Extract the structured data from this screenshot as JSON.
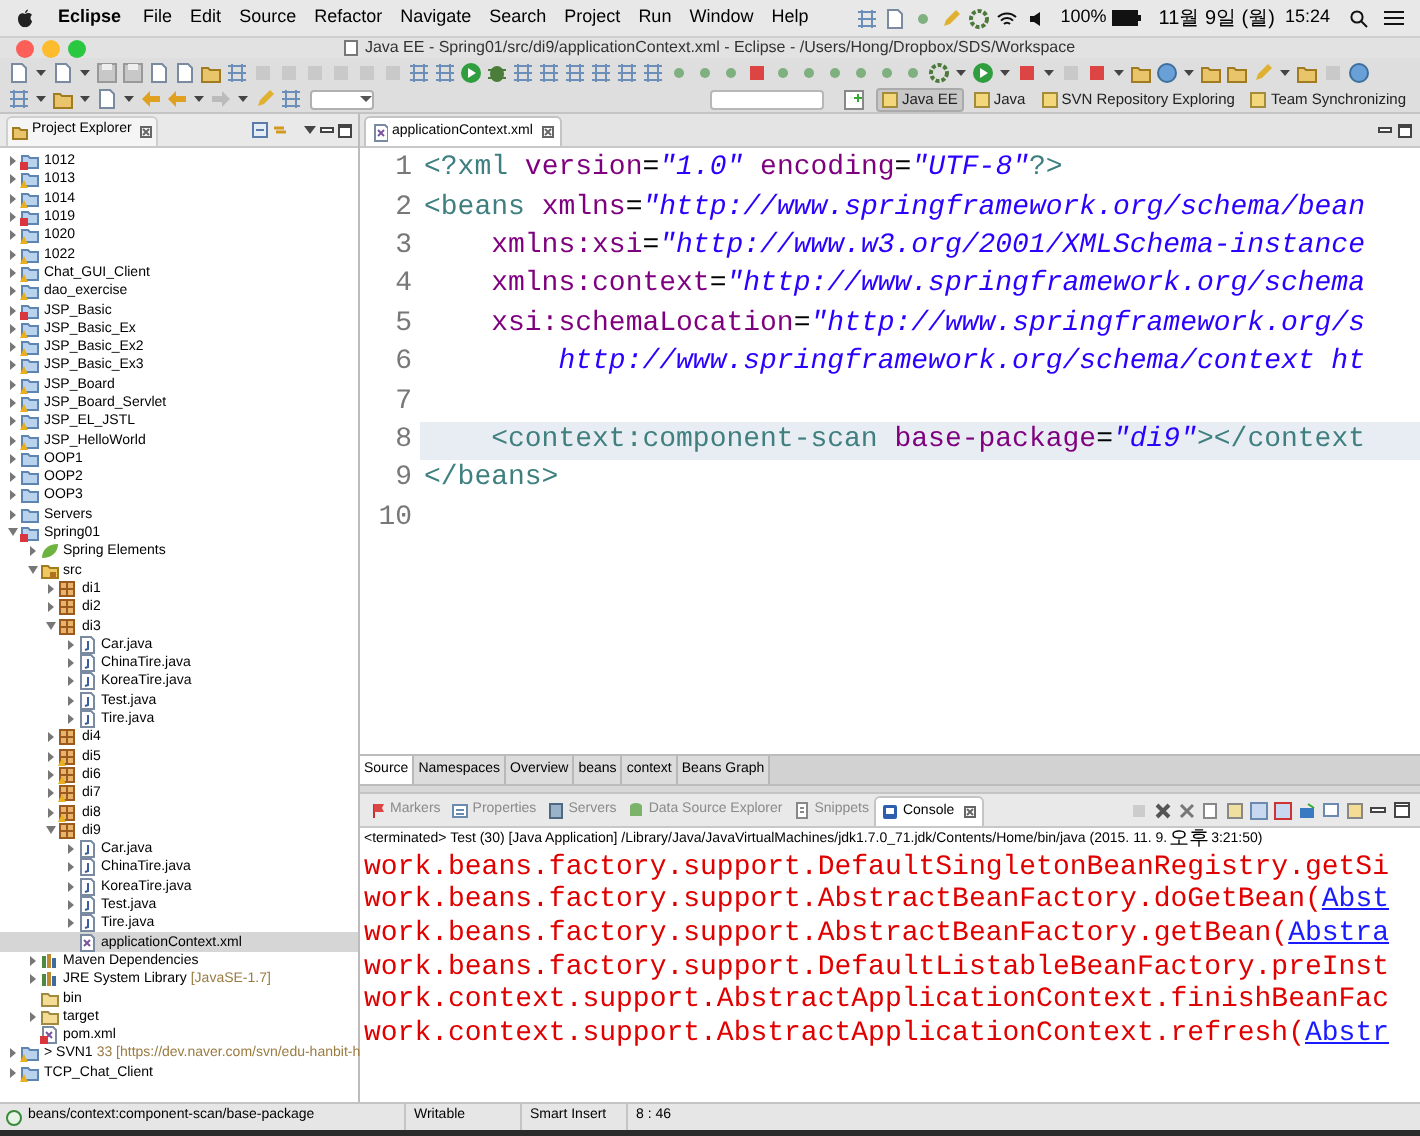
{
  "menubar": {
    "items": [
      {
        "label": "Eclipse",
        "kind": "app"
      },
      {
        "label": "File",
        "kind": "menu"
      },
      {
        "label": "Edit",
        "kind": "menu"
      },
      {
        "label": "Source",
        "kind": "menu"
      },
      {
        "label": "Refactor",
        "kind": "menu"
      },
      {
        "label": "Navigate",
        "kind": "menu"
      },
      {
        "label": "Search",
        "kind": "menu"
      },
      {
        "label": "Project",
        "kind": "menu"
      },
      {
        "label": "Run",
        "kind": "menu"
      },
      {
        "label": "Window",
        "kind": "menu"
      },
      {
        "label": "Help",
        "kind": "menu"
      }
    ],
    "battery": "100%",
    "date": "11월 9일 (월)",
    "time": "15:24"
  },
  "window": {
    "title": "Java EE - Spring01/src/di9/applicationContext.xml - Eclipse - /Users/Hong/Dropbox/SDS/Workspace"
  },
  "perspectives": [
    {
      "label": "Java EE",
      "selected": true
    },
    {
      "label": "Java",
      "selected": false
    },
    {
      "label": "SVN Repository Exploring",
      "selected": false
    },
    {
      "label": "Team Synchronizing",
      "selected": false
    }
  ],
  "project_explorer": {
    "title": "Project Explorer",
    "tree": [
      {
        "label": "1012",
        "kind": "project",
        "error": true,
        "expanded": false,
        "selected": false
      },
      {
        "label": "1013",
        "kind": "project",
        "warning": true,
        "expanded": false,
        "selected": false
      },
      {
        "label": "1014",
        "kind": "project",
        "warning": true,
        "expanded": false,
        "selected": false
      },
      {
        "label": "1019",
        "kind": "project",
        "error": true,
        "expanded": false,
        "selected": false
      },
      {
        "label": "1020",
        "kind": "project",
        "warning": true,
        "expanded": false,
        "selected": false
      },
      {
        "label": "1022",
        "kind": "project",
        "warning": true,
        "expanded": false,
        "selected": false
      },
      {
        "label": "Chat_GUI_Client",
        "kind": "project",
        "warning": true,
        "expanded": false,
        "selected": false
      },
      {
        "label": "dao_exercise",
        "kind": "project",
        "warning": true,
        "expanded": false,
        "selected": false
      },
      {
        "label": "JSP_Basic",
        "kind": "project",
        "error": true,
        "expanded": false,
        "selected": false
      },
      {
        "label": "JSP_Basic_Ex",
        "kind": "project",
        "warning": true,
        "expanded": false,
        "selected": false
      },
      {
        "label": "JSP_Basic_Ex2",
        "kind": "project",
        "warning": true,
        "expanded": false,
        "selected": false
      },
      {
        "label": "JSP_Basic_Ex3",
        "kind": "project",
        "warning": true,
        "expanded": false,
        "selected": false
      },
      {
        "label": "JSP_Board",
        "kind": "project",
        "warning": true,
        "expanded": false,
        "selected": false
      },
      {
        "label": "JSP_Board_Servlet",
        "kind": "project",
        "warning": true,
        "expanded": false,
        "selected": false
      },
      {
        "label": "JSP_EL_JSTL",
        "kind": "project",
        "warning": true,
        "expanded": false,
        "selected": false
      },
      {
        "label": "JSP_HelloWorld",
        "kind": "project",
        "warning": true,
        "expanded": false,
        "selected": false
      },
      {
        "label": "OOP1",
        "kind": "project",
        "expanded": false,
        "selected": false
      },
      {
        "label": "OOP2",
        "kind": "project",
        "expanded": false,
        "selected": false
      },
      {
        "label": "OOP3",
        "kind": "project",
        "expanded": false,
        "selected": false
      },
      {
        "label": "Servers",
        "kind": "project",
        "expanded": false,
        "selected": false
      },
      {
        "label": "Spring01",
        "kind": "project",
        "error": true,
        "expanded": true,
        "selected": false,
        "children": [
          {
            "label": "Spring Elements",
            "kind": "spring",
            "expanded": false,
            "selected": false
          },
          {
            "label": "src",
            "kind": "source",
            "expanded": true,
            "selected": false,
            "children": [
              {
                "label": "di1",
                "kind": "package",
                "expanded": false,
                "selected": false
              },
              {
                "label": "di2",
                "kind": "package",
                "expanded": false,
                "selected": false
              },
              {
                "label": "di3",
                "kind": "package",
                "expanded": true,
                "selected": false,
                "children": [
                  {
                    "label": "Car.java",
                    "kind": "java",
                    "expanded": false,
                    "selected": false
                  },
                  {
                    "label": "ChinaTire.java",
                    "kind": "java",
                    "expanded": false,
                    "selected": false
                  },
                  {
                    "label": "KoreaTire.java",
                    "kind": "java",
                    "expanded": false,
                    "selected": false
                  },
                  {
                    "label": "Test.java",
                    "kind": "java",
                    "expanded": false,
                    "selected": false
                  },
                  {
                    "label": "Tire.java",
                    "kind": "java",
                    "expanded": false,
                    "selected": false
                  }
                ]
              },
              {
                "label": "di4",
                "kind": "package",
                "expanded": false,
                "selected": false
              },
              {
                "label": "di5",
                "kind": "package",
                "warning": true,
                "expanded": false,
                "selected": false
              },
              {
                "label": "di6",
                "kind": "package",
                "warning": true,
                "expanded": false,
                "selected": false
              },
              {
                "label": "di7",
                "kind": "package",
                "warning": true,
                "expanded": false,
                "selected": false
              },
              {
                "label": "di8",
                "kind": "package",
                "warning": true,
                "expanded": false,
                "selected": false
              },
              {
                "label": "di9",
                "kind": "package",
                "expanded": true,
                "selected": false,
                "children": [
                  {
                    "label": "Car.java",
                    "kind": "java",
                    "expanded": false,
                    "selected": false
                  },
                  {
                    "label": "ChinaTire.java",
                    "kind": "java",
                    "expanded": false,
                    "selected": false
                  },
                  {
                    "label": "KoreaTire.java",
                    "kind": "java",
                    "expanded": false,
                    "selected": false
                  },
                  {
                    "label": "Test.java",
                    "kind": "java",
                    "expanded": false,
                    "selected": false
                  },
                  {
                    "label": "Tire.java",
                    "kind": "java",
                    "expanded": false,
                    "selected": false
                  },
                  {
                    "label": "applicationContext.xml",
                    "kind": "xml",
                    "selected": true
                  }
                ]
              }
            ]
          },
          {
            "label": "Maven Dependencies",
            "kind": "library",
            "expanded": false,
            "selected": false
          },
          {
            "label": "JRE System Library",
            "decoration": "[JavaSE-1.7]",
            "kind": "library",
            "expanded": false,
            "selected": false
          },
          {
            "label": "bin",
            "kind": "folder",
            "selected": false
          },
          {
            "label": "target",
            "kind": "folder",
            "expanded": false,
            "selected": false
          },
          {
            "label": "pom.xml",
            "kind": "xml",
            "error": true,
            "selected": false
          }
        ]
      },
      {
        "label": "> SVN1",
        "decoration": "33 [https://dev.naver.com/svn/edu-hanbit-h",
        "kind": "project",
        "warning": true,
        "expanded": false,
        "selected": false
      },
      {
        "label": "TCP_Chat_Client",
        "kind": "project",
        "warning": true,
        "expanded": false,
        "selected": false
      }
    ]
  },
  "editor": {
    "tab": "applicationContext.xml",
    "lines": [
      {
        "number": "1",
        "current": false,
        "tokens": [
          {
            "kind": "pi",
            "text": "<?xml"
          },
          {
            "kind": "attr",
            "text": " version"
          },
          {
            "kind": "plain",
            "text": "="
          },
          {
            "kind": "value",
            "text": "\"1.0\""
          },
          {
            "kind": "attr",
            "text": " encoding"
          },
          {
            "kind": "plain",
            "text": "="
          },
          {
            "kind": "value",
            "text": "\"UTF-8\""
          },
          {
            "kind": "pi",
            "text": "?>"
          }
        ]
      },
      {
        "number": "2",
        "current": false,
        "tokens": [
          {
            "kind": "tag",
            "text": "<beans"
          },
          {
            "kind": "attr",
            "text": " xmlns"
          },
          {
            "kind": "plain",
            "text": "="
          },
          {
            "kind": "value",
            "text": "\"http://www.springframework.org/schema/bean"
          }
        ]
      },
      {
        "number": "3",
        "current": false,
        "tokens": [
          {
            "kind": "attr",
            "text": "    xmlns:xsi"
          },
          {
            "kind": "plain",
            "text": "="
          },
          {
            "kind": "value",
            "text": "\"http://www.w3.org/2001/XMLSchema-instance"
          }
        ]
      },
      {
        "number": "4",
        "current": false,
        "tokens": [
          {
            "kind": "attr",
            "text": "    xmlns:context"
          },
          {
            "kind": "plain",
            "text": "="
          },
          {
            "kind": "value",
            "text": "\"http://www.springframework.org/schema"
          }
        ]
      },
      {
        "number": "5",
        "current": false,
        "tokens": [
          {
            "kind": "attr",
            "text": "    xsi:schemaLocation"
          },
          {
            "kind": "plain",
            "text": "="
          },
          {
            "kind": "value",
            "text": "\"http://www.springframework.org/s"
          }
        ]
      },
      {
        "number": "6",
        "current": false,
        "tokens": [
          {
            "kind": "value",
            "text": "        http://www.springframework.org/schema/context ht"
          }
        ]
      },
      {
        "number": "7",
        "current": false
      },
      {
        "number": "8",
        "current": true,
        "tokens": [
          {
            "kind": "tag",
            "text": "    <context:component-scan"
          },
          {
            "kind": "attr",
            "text": " base-package"
          },
          {
            "kind": "plain",
            "text": "="
          },
          {
            "kind": "value",
            "text": "\"di9\""
          },
          {
            "kind": "tag",
            "text": "></context"
          }
        ]
      },
      {
        "number": "9",
        "current": false,
        "tokens": [
          {
            "kind": "tag",
            "text": "</beans>"
          }
        ]
      },
      {
        "number": "10",
        "current": false
      }
    ],
    "bottom_tabs": [
      {
        "label": "Source",
        "selected": true
      },
      {
        "label": "Namespaces",
        "selected": false
      },
      {
        "label": "Overview",
        "selected": false
      },
      {
        "label": "beans",
        "selected": false
      },
      {
        "label": "context",
        "selected": false
      },
      {
        "label": "Beans Graph",
        "selected": false
      }
    ]
  },
  "bottom_views": [
    {
      "label": "Markers",
      "kind": "markers",
      "selected": false
    },
    {
      "label": "Properties",
      "kind": "properties",
      "selected": false
    },
    {
      "label": "Servers",
      "kind": "servers",
      "selected": false
    },
    {
      "label": "Data Source Explorer",
      "kind": "datasource",
      "selected": false
    },
    {
      "label": "Snippets",
      "kind": "snippets",
      "selected": false
    },
    {
      "label": "Console",
      "kind": "console",
      "selected": true
    }
  ],
  "console": {
    "info": "<terminated> Test (30) [Java Application] /Library/Java/JavaVirtualMachines/jdk1.7.0_71.jdk/Contents/Home/bin/java (2015. 11. 9. ",
    "info_korean": "오후",
    "info_end": " 3:21:50)",
    "lines": [
      [
        {
          "kind": "error",
          "text": "work.beans.factory.support.DefaultSingletonBeanRegistry.getSi"
        }
      ],
      [
        {
          "kind": "error",
          "text": "work.beans.factory.support.AbstractBeanFactory.doGetBean("
        },
        {
          "kind": "link",
          "text": "Abst"
        }
      ],
      [
        {
          "kind": "error",
          "text": "work.beans.factory.support.AbstractBeanFactory.getBean("
        },
        {
          "kind": "link",
          "text": "Abstra"
        }
      ],
      [
        {
          "kind": "error",
          "text": "work.beans.factory.support.DefaultListableBeanFactory.preInst"
        }
      ],
      [
        {
          "kind": "error",
          "text": "work.context.support.AbstractApplicationContext.finishBeanFac"
        }
      ],
      [
        {
          "kind": "error",
          "text": "work.context.support.AbstractApplicationContext.refresh("
        },
        {
          "kind": "link",
          "text": "Abstr"
        }
      ]
    ]
  },
  "status_bar": {
    "path": "beans/context:component-scan/base-package",
    "fields": [
      "Writable",
      "Smart Insert",
      "8 : 46"
    ]
  }
}
